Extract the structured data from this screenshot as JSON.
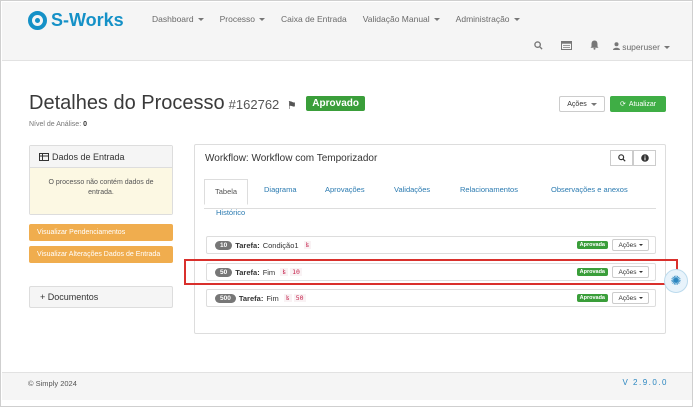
{
  "brand": {
    "name": "S-Works",
    "color": "#1591c7"
  },
  "nav": {
    "items": [
      "Dashboard",
      "Processo",
      "Caixa de Entrada",
      "Validação Manual",
      "Administração"
    ],
    "icons": [
      "search-icon",
      "calendar-icon",
      "bell-icon"
    ],
    "user": "superuser"
  },
  "page": {
    "title": "Detalhes do Processo",
    "id": "#162762",
    "status": "Aprovado",
    "nivel_label": "Nível de Análise:",
    "nivel_value": "0",
    "acoes_label": "Ações",
    "atualizar_label": "Atualizar"
  },
  "sidebar": {
    "dados_title": "Dados de Entrada",
    "dados_message": "O processo não contém dados de entrada.",
    "btn_pendencias": "Visualizar Pendenciamentos",
    "btn_alteracoes": "Visualizar Alterações Dados de Entrada",
    "documentos": "+ Documentos"
  },
  "workflow": {
    "title": "Workflow: Workflow com Temporizador",
    "tabs": [
      "Tabela",
      "Diagrama",
      "Aprovações",
      "Validações",
      "Relacionamentos",
      "Observações e anexos",
      "Histórico"
    ],
    "active_tab": "Tabela",
    "tasks": [
      {
        "num": "10",
        "label": "Tarefa:",
        "name": "Condição1",
        "code_icon": "ʪ",
        "code": "",
        "status": "Aprovada",
        "acoes": "Ações"
      },
      {
        "num": "50",
        "label": "Tarefa:",
        "name": "Fim",
        "code_icon": "ʪ",
        "code": "10",
        "status": "Aprovada",
        "acoes": "Ações"
      },
      {
        "num": "500",
        "label": "Tarefa:",
        "name": "Fim",
        "code_icon": "ʪ",
        "code": "50",
        "status": "Aprovada",
        "acoes": "Ações"
      }
    ]
  },
  "footer": {
    "copyright": "© Simply 2024",
    "version": "V 2.9.0.0"
  },
  "colors": {
    "success": "#3a9e3a",
    "warning": "#f0ad4e",
    "link": "#2a7ab0",
    "highlight": "#d9302c"
  }
}
